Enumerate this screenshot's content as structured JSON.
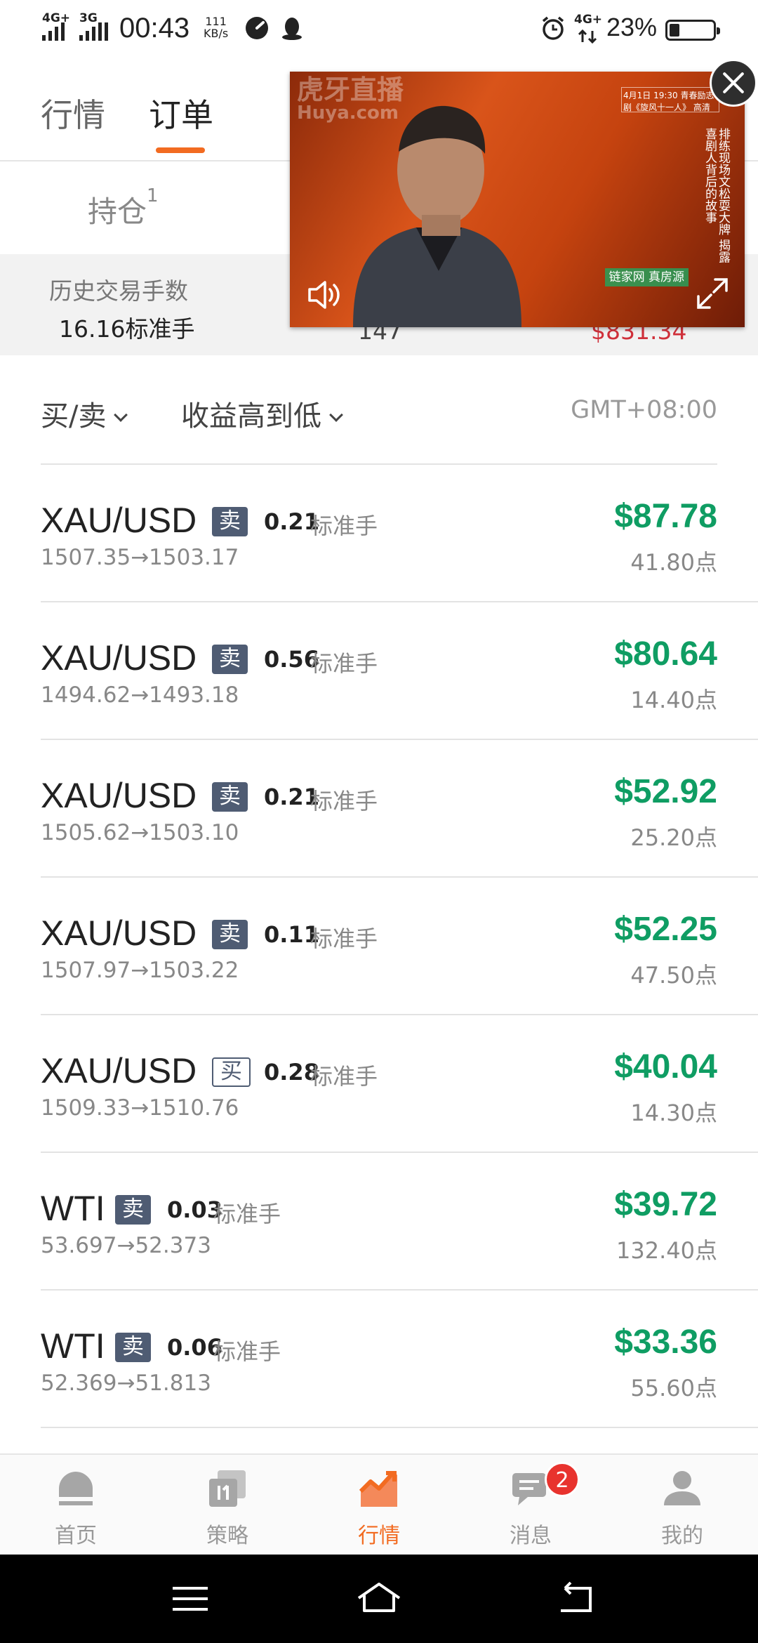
{
  "status_bar": {
    "net1": "4G+",
    "net2": "3G",
    "time": "00:43",
    "speed_value": "111",
    "speed_unit": "KB/s",
    "net3": "4G+",
    "battery": "23%"
  },
  "top_tabs": [
    {
      "label": "行情"
    },
    {
      "label": "订单"
    }
  ],
  "holdings_tab": {
    "label": "持仓",
    "count": "1"
  },
  "stats": {
    "history_label": "历史交易手数",
    "history_value": "16.16标准手",
    "col2_value_partial": "147",
    "col3_value_partial": "$831.34"
  },
  "video": {
    "watermark": "虎牙直播",
    "watermark_sub": "Huya.com",
    "corner_text": "4月1日 19:30 青春励志剧《旋风十一人》 高清",
    "side_text": "排练现场文松耍大牌 揭露喜剧人背后的故事",
    "brand": "链家网 真房源"
  },
  "filters": {
    "side_label": "买/卖",
    "sort_label": "收益高到低",
    "timezone": "GMT+08:00"
  },
  "orders": [
    {
      "symbol": "XAU/USD",
      "side": "卖",
      "lots": "0.21",
      "unit": "标准手",
      "prices": "1507.35→1503.17",
      "profit": "$87.78",
      "points": "41.80点"
    },
    {
      "symbol": "XAU/USD",
      "side": "卖",
      "lots": "0.56",
      "unit": "标准手",
      "prices": "1494.62→1493.18",
      "profit": "$80.64",
      "points": "14.40点"
    },
    {
      "symbol": "XAU/USD",
      "side": "卖",
      "lots": "0.21",
      "unit": "标准手",
      "prices": "1505.62→1503.10",
      "profit": "$52.92",
      "points": "25.20点"
    },
    {
      "symbol": "XAU/USD",
      "side": "卖",
      "lots": "0.11",
      "unit": "标准手",
      "prices": "1507.97→1503.22",
      "profit": "$52.25",
      "points": "47.50点"
    },
    {
      "symbol": "XAU/USD",
      "side": "买",
      "lots": "0.28",
      "unit": "标准手",
      "prices": "1509.33→1510.76",
      "profit": "$40.04",
      "points": "14.30点"
    },
    {
      "symbol": "WTI",
      "side": "卖",
      "lots": "0.03",
      "unit": "标准手",
      "prices": "53.697→52.373",
      "profit": "$39.72",
      "points": "132.40点"
    },
    {
      "symbol": "WTI",
      "side": "卖",
      "lots": "0.06",
      "unit": "标准手",
      "prices": "52.369→51.813",
      "profit": "$33.36",
      "points": "55.60点"
    }
  ],
  "bottom_nav": [
    {
      "label": "首页",
      "icon": "home-icon"
    },
    {
      "label": "策略",
      "icon": "strategy-icon"
    },
    {
      "label": "行情",
      "icon": "market-chart-icon"
    },
    {
      "label": "消息",
      "icon": "message-icon",
      "badge": "2"
    },
    {
      "label": "我的",
      "icon": "profile-icon"
    }
  ],
  "colors": {
    "accent": "#f26b21",
    "profit_green": "#0f9d63",
    "sell_badge": "#4f5c73",
    "loss_red": "#d0303a"
  }
}
